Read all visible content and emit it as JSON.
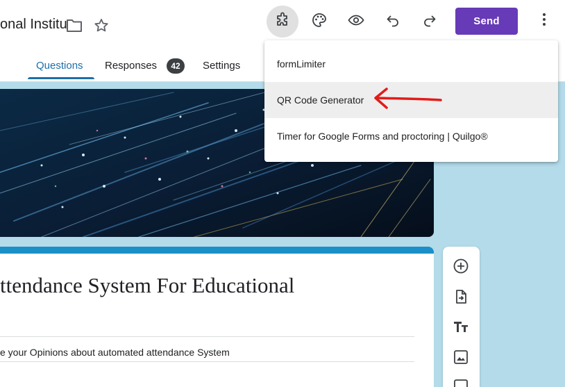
{
  "header": {
    "title": "onal Institu",
    "send_label": "Send",
    "icons": [
      "folder-icon",
      "star-icon",
      "addons-puzzle-icon",
      "palette-icon",
      "preview-eye-icon",
      "undo-icon",
      "redo-icon",
      "more-vert-icon"
    ]
  },
  "tabs": [
    {
      "label": "Questions",
      "active": true
    },
    {
      "label": "Responses",
      "badge": "42"
    },
    {
      "label": "Settings"
    }
  ],
  "form": {
    "title": "ttendance System For Educational",
    "description": "e your Opinions about automated attendance System"
  },
  "addons_menu": {
    "items": [
      {
        "label": "formLimiter"
      },
      {
        "label": "QR Code Generator",
        "highlighted": true
      },
      {
        "label": "Timer for Google Forms and proctoring | Quilgo®"
      }
    ]
  },
  "sidebar": {
    "tools": [
      "add-question-icon",
      "import-questions-icon",
      "add-title-icon",
      "add-image-icon",
      "add-video-icon"
    ]
  },
  "colors": {
    "accent": "#673ab7",
    "tab_active": "#1b6fa8",
    "card_top": "#1b8fc8",
    "background": "#b3dbea",
    "annotation_arrow": "#e31b1b"
  }
}
